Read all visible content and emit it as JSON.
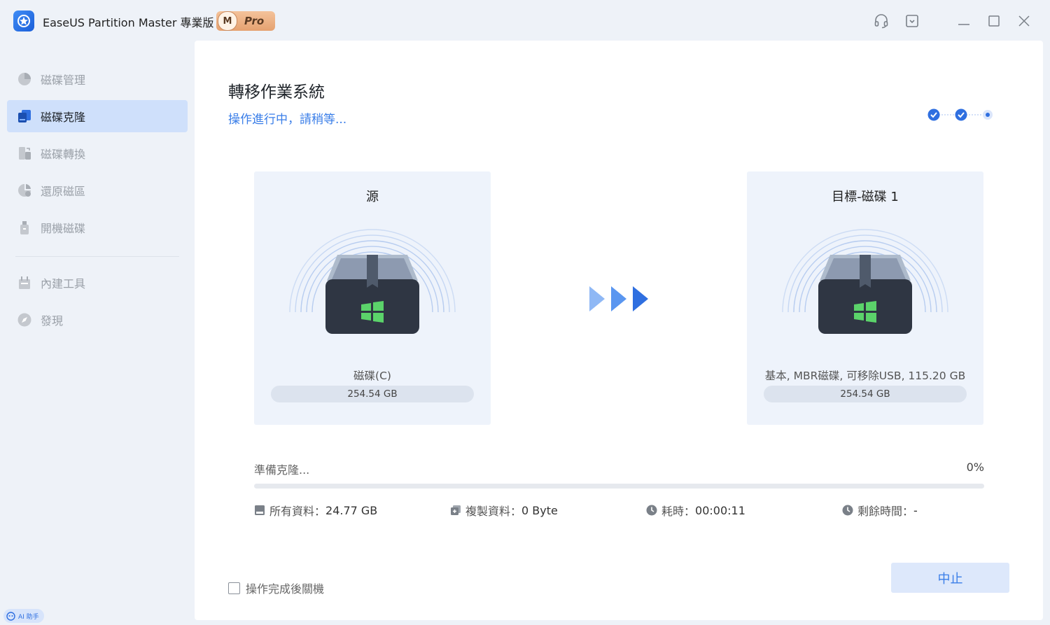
{
  "app": {
    "title": "EaseUS Partition Master 專業版",
    "badge_m": "M",
    "badge_label": "Pro",
    "icons": [
      "headset-icon",
      "dropdown-box-icon",
      "minimize-icon",
      "maximize-icon",
      "close-icon"
    ]
  },
  "sidebar": {
    "items": [
      {
        "label": "磁碟管理",
        "icon": "pie-chart-icon",
        "active": false
      },
      {
        "label": "磁碟克隆",
        "icon": "clone-disk-icon",
        "active": true
      },
      {
        "label": "磁碟轉換",
        "icon": "convert-disk-icon",
        "active": false
      },
      {
        "label": "還原磁區",
        "icon": "recover-partition-icon",
        "active": false
      },
      {
        "label": "開機磁碟",
        "icon": "bootable-usb-icon",
        "active": false
      }
    ],
    "tools": [
      {
        "label": "內建工具",
        "icon": "toolbox-icon"
      },
      {
        "label": "發現",
        "icon": "compass-icon"
      }
    ],
    "ai_label": "AI 助手"
  },
  "main": {
    "title": "轉移作業系統",
    "subtitle": "操作進行中，請稍等...",
    "steps": [
      "done",
      "done",
      "current"
    ],
    "source": {
      "title": "源",
      "disk_name": "磁碟(C)",
      "size": "254.54 GB"
    },
    "target": {
      "title": "目標-磁碟 1",
      "disk_name": "基本, MBR磁碟, 可移除USB, 115.20 GB",
      "size": "254.54 GB"
    },
    "status": {
      "label": "準備克隆...",
      "percent_text": "0%",
      "progress": 0
    },
    "stats": [
      {
        "label": "所有資料：",
        "value": "24.77 GB",
        "icon": "data-icon"
      },
      {
        "label": "複製資料：",
        "value": "0 Byte",
        "icon": "copy-icon"
      },
      {
        "label": "耗時：",
        "value": "00:00:11",
        "icon": "clock-icon"
      },
      {
        "label": "剩餘時間：",
        "value": "-",
        "icon": "clock-icon"
      }
    ],
    "shutdown_label": "操作完成後關機",
    "stop_label": "中止"
  },
  "colors": {
    "accent": "#3a7ee8",
    "active_nav": "#cfe0fb",
    "windows_green": "#5bd36a"
  }
}
